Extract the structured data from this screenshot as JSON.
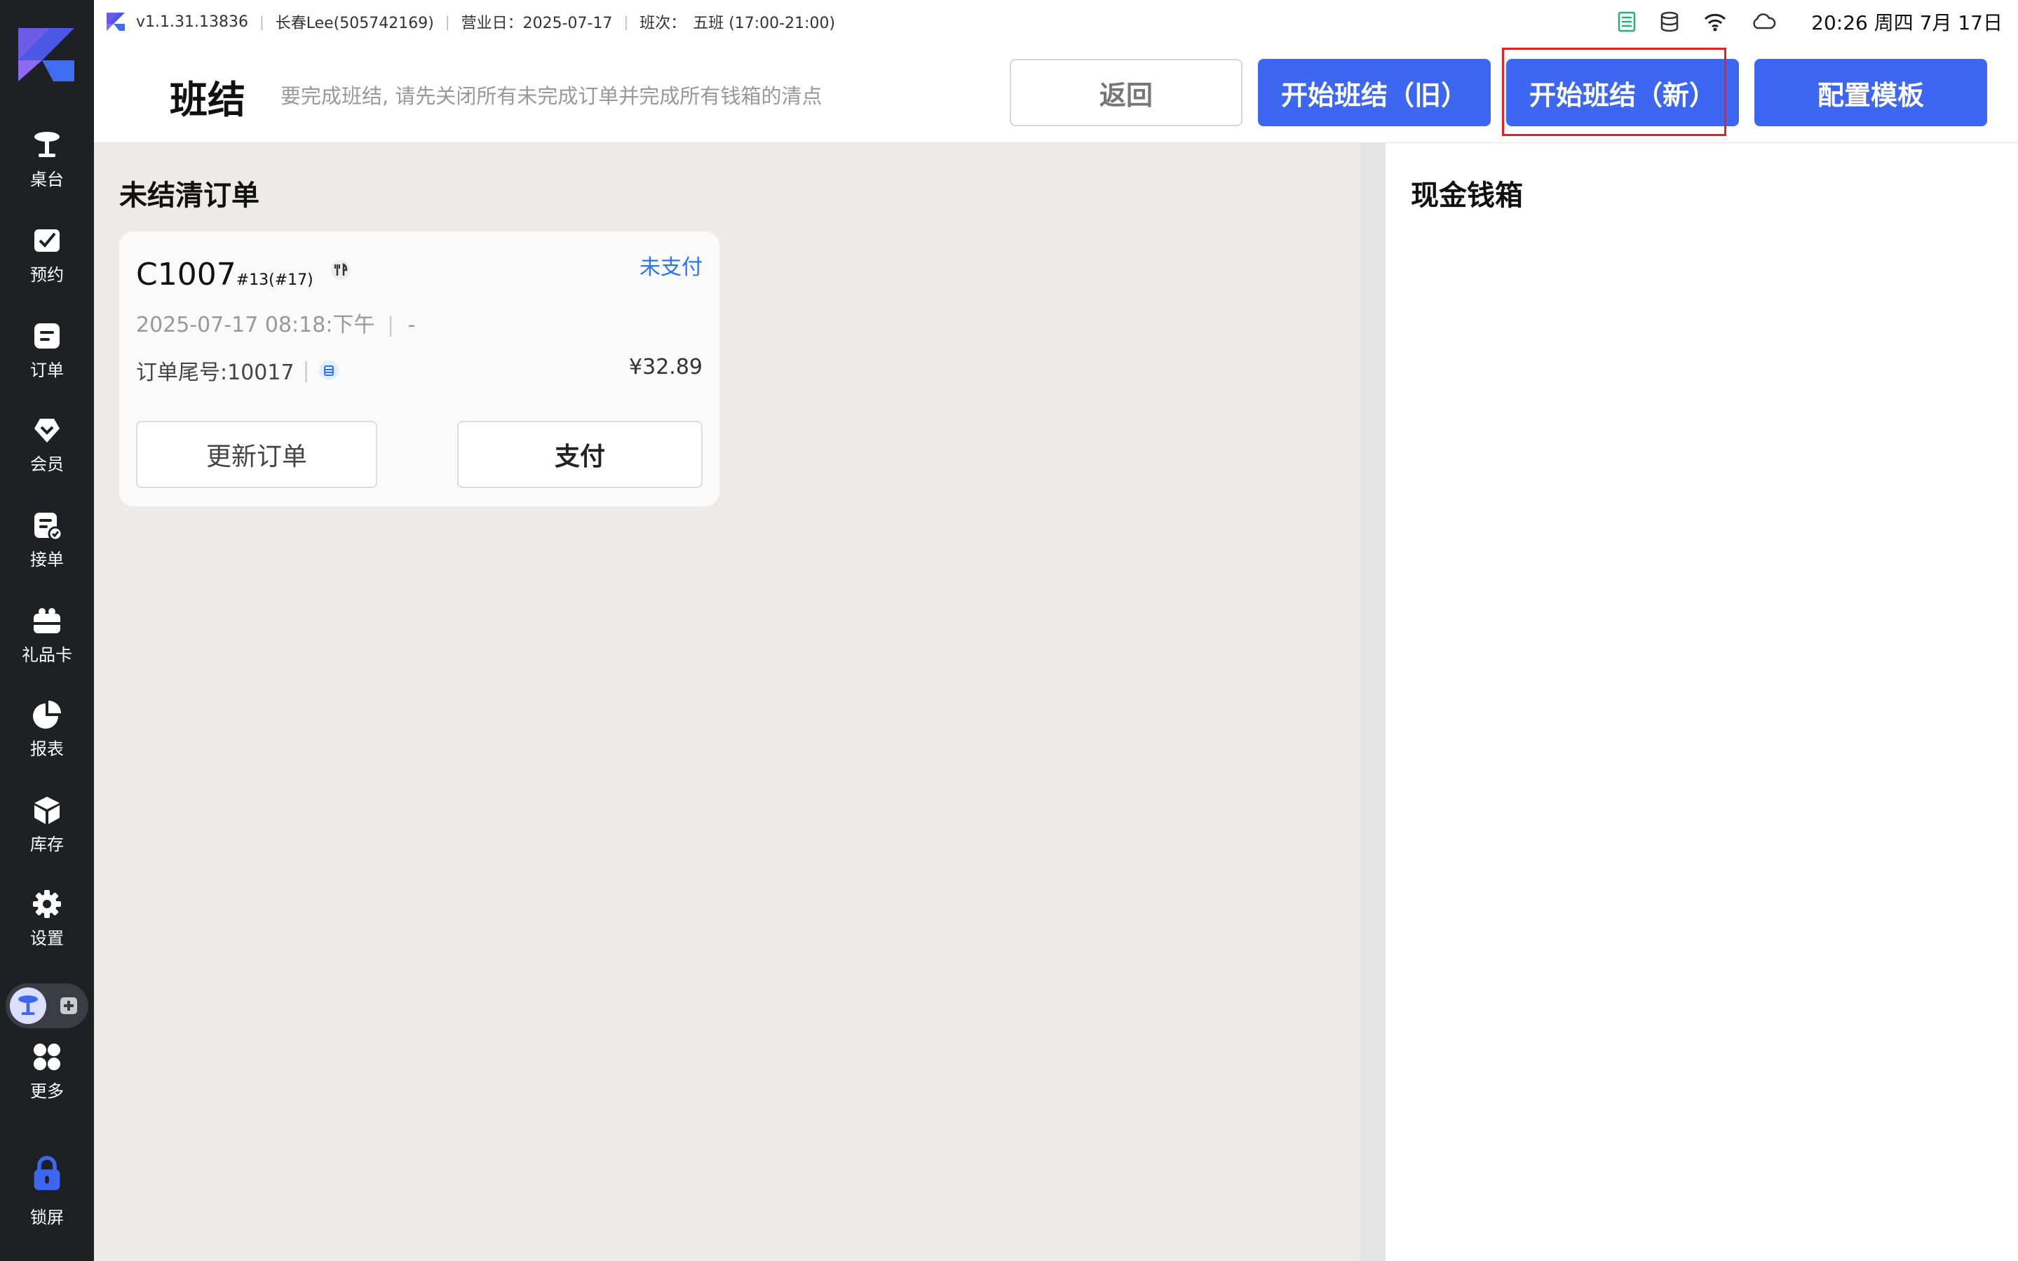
{
  "status_bar": {
    "version": "v1.1.31.13836",
    "user": "长春Lee(505742169)",
    "business_day": "营业日：2025-07-17",
    "shift_label": "班次：",
    "shift_value": "五班 (17:00-21:00)",
    "datetime": "20:26 周四 7月 17日"
  },
  "header": {
    "title": "班结",
    "hint": "要完成班结, 请先关闭所有未完成订单并完成所有钱箱的清点",
    "buttons": {
      "back": "返回",
      "start_old": "开始班结（旧）",
      "start_new": "开始班结（新）",
      "config_template": "配置模板"
    }
  },
  "sidebar": {
    "items": [
      {
        "label": "桌台",
        "icon": "table-icon"
      },
      {
        "label": "预约",
        "icon": "reservation-icon"
      },
      {
        "label": "订单",
        "icon": "order-icon"
      },
      {
        "label": "会员",
        "icon": "member-icon"
      },
      {
        "label": "接单",
        "icon": "accept-order-icon"
      },
      {
        "label": "礼品卡",
        "icon": "gift-card-icon"
      },
      {
        "label": "报表",
        "icon": "report-icon"
      },
      {
        "label": "库存",
        "icon": "inventory-icon"
      },
      {
        "label": "设置",
        "icon": "settings-icon"
      },
      {
        "label": "更多",
        "icon": "more-icon"
      },
      {
        "label": "锁屏",
        "icon": "lock-icon"
      }
    ]
  },
  "unsettled": {
    "title": "未结清订单",
    "orders": [
      {
        "number": "C1007",
        "sub": "#13(#17)",
        "status": "未支付",
        "time": "2025-07-17 08:18:下午",
        "dash": "-",
        "tail": "订单尾号:10017",
        "amount": "¥32.89",
        "update_label": "更新订单",
        "pay_label": "支付"
      }
    ]
  },
  "cashbox": {
    "title": "现金钱箱"
  },
  "colors": {
    "primary": "#3d67f0",
    "sidebar": "#1f2024",
    "status_unpaid": "#2d74f0",
    "highlight": "#e02424"
  }
}
